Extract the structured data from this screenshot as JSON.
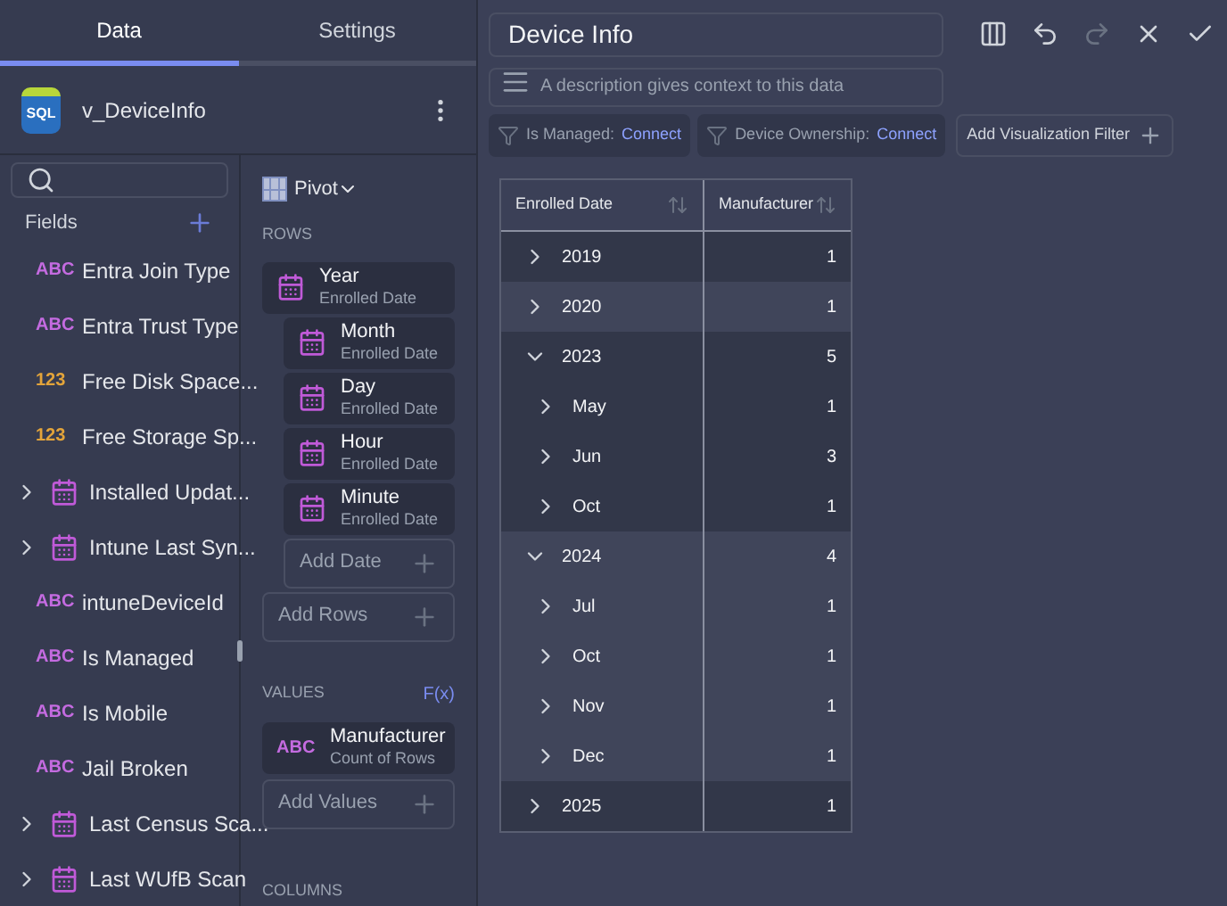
{
  "tabs": [
    {
      "label": "Data",
      "selected": true
    },
    {
      "label": "Settings",
      "selected": false
    }
  ],
  "source": {
    "icon_text": "SQL",
    "name": "v_DeviceInfo"
  },
  "fields": {
    "heading": "Fields",
    "items": [
      {
        "kind": "text",
        "badge": "ABC",
        "label": "Entra Join Type"
      },
      {
        "kind": "text",
        "badge": "ABC",
        "label": "Entra Trust Type"
      },
      {
        "kind": "number",
        "badge": "123",
        "label": "Free Disk Space..."
      },
      {
        "kind": "number",
        "badge": "123",
        "label": "Free Storage Sp..."
      },
      {
        "kind": "date",
        "expanded": false,
        "label": "Installed Updat..."
      },
      {
        "kind": "date",
        "expanded": false,
        "label": "Intune Last Syn..."
      },
      {
        "kind": "text",
        "badge": "ABC",
        "label": "intuneDeviceId"
      },
      {
        "kind": "text",
        "badge": "ABC",
        "label": "Is Managed"
      },
      {
        "kind": "text",
        "badge": "ABC",
        "label": "Is Mobile"
      },
      {
        "kind": "text",
        "badge": "ABC",
        "label": "Jail Broken"
      },
      {
        "kind": "date",
        "expanded": false,
        "label": "Last Census Sca..."
      },
      {
        "kind": "date",
        "expanded": false,
        "label": "Last WUfB Scan"
      }
    ]
  },
  "config": {
    "view": "Pivot",
    "rows_heading": "ROWS",
    "rows": [
      {
        "title": "Year",
        "subtitle": "Enrolled Date",
        "children": [
          {
            "title": "Month",
            "subtitle": "Enrolled Date"
          },
          {
            "title": "Day",
            "subtitle": "Enrolled Date"
          },
          {
            "title": "Hour",
            "subtitle": "Enrolled Date"
          },
          {
            "title": "Minute",
            "subtitle": "Enrolled Date"
          }
        ]
      }
    ],
    "add_date": "Add Date",
    "add_rows": "Add Rows",
    "values_heading": "VALUES",
    "formula": "F(x)",
    "values": [
      {
        "badge": "ABC",
        "title": "Manufacturer",
        "subtitle": "Count of Rows"
      }
    ],
    "add_values": "Add Values",
    "columns_heading": "COLUMNS"
  },
  "editor": {
    "title": "Device Info",
    "description": {
      "placeholder": "A description gives context to this data"
    },
    "filters": [
      {
        "label": "Is Managed:",
        "link": "Connect"
      },
      {
        "label": "Device Ownership:",
        "link": "Connect"
      }
    ],
    "add_filter": "Add Visualization Filter"
  },
  "table": {
    "columns": [
      "Enrolled Date",
      "Manufacturer"
    ],
    "rows": [
      {
        "label": "2019",
        "value": "1",
        "expanded": false
      },
      {
        "label": "2020",
        "value": "1",
        "expanded": false
      },
      {
        "label": "2023",
        "value": "5",
        "expanded": true,
        "children": [
          {
            "label": "May",
            "value": "1",
            "expanded": false
          },
          {
            "label": "Jun",
            "value": "3",
            "expanded": false
          },
          {
            "label": "Oct",
            "value": "1",
            "expanded": false
          }
        ]
      },
      {
        "label": "2024",
        "value": "4",
        "expanded": true,
        "children": [
          {
            "label": "Jul",
            "value": "1",
            "expanded": false
          },
          {
            "label": "Oct",
            "value": "1",
            "expanded": false
          },
          {
            "label": "Nov",
            "value": "1",
            "expanded": false
          },
          {
            "label": "Dec",
            "value": "1",
            "expanded": false
          }
        ]
      },
      {
        "label": "2025",
        "value": "1",
        "expanded": false
      }
    ]
  }
}
